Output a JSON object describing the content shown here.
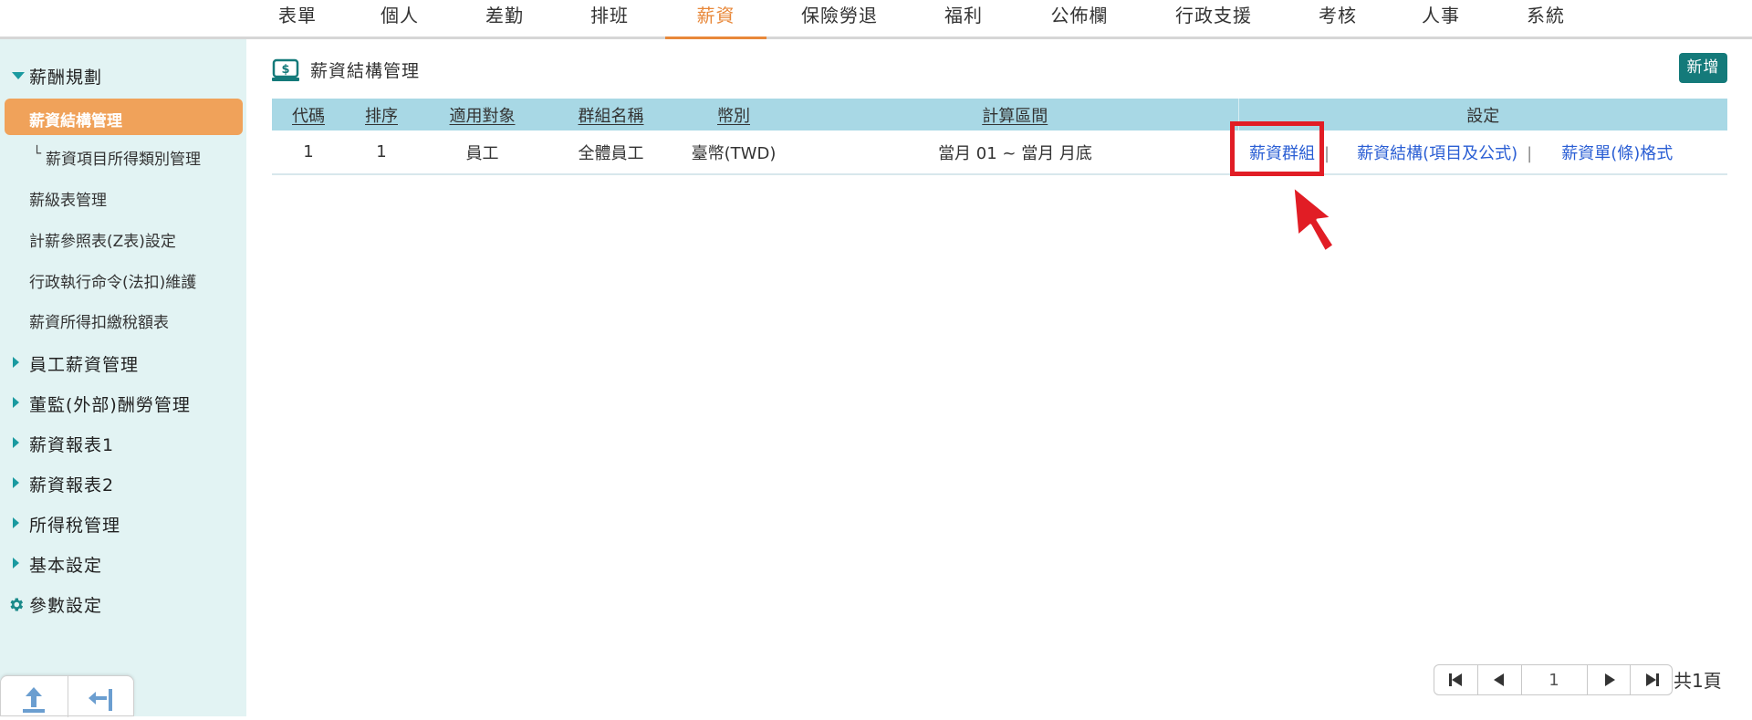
{
  "topnav": {
    "tabs": [
      "表單",
      "個人",
      "差勤",
      "排班",
      "薪資",
      "保險勞退",
      "福利",
      "公佈欄",
      "行政支援",
      "考核",
      "人事",
      "系統"
    ],
    "active": "薪資"
  },
  "sidebar": {
    "group_salary_planning": "薪酬規劃",
    "sub_items": [
      "薪資結構管理",
      "薪資項目所得類別管理",
      "薪級表管理",
      "計薪參照表(Z表)設定",
      "行政執行命令(法扣)維護",
      "薪資所得扣繳稅額表"
    ],
    "sub_prefix": "└",
    "groups": [
      "員工薪資管理",
      "董監(外部)酬勞管理",
      "薪資報表1",
      "薪資報表2",
      "所得稅管理",
      "基本設定"
    ],
    "param_settings": "參數設定"
  },
  "main": {
    "title": "薪資結構管理",
    "add_button": "新增",
    "table": {
      "headers": [
        "代碼",
        "排序",
        "適用對象",
        "群組名稱",
        "幣別",
        "計算區間",
        "設定"
      ],
      "rows": [
        {
          "code": "1",
          "order": "1",
          "target": "員工",
          "group_name": "全體員工",
          "currency": "臺幣(TWD)",
          "period": "當月 01 ~ 當月 月底",
          "links": [
            "薪資群組",
            "薪資結構(項目及公式)",
            "薪資單(條)格式"
          ],
          "separator": "|"
        }
      ]
    }
  },
  "pager": {
    "page_value": "1",
    "total_pages": "共1頁"
  },
  "colors": {
    "accent_orange": "#e8883a",
    "sidebar_bg": "#e2f3f3",
    "header_bg": "#a8d8e5",
    "add_button_bg": "#147a7a",
    "link_blue": "#2a5ed4",
    "highlight_red": "#e11d25"
  }
}
